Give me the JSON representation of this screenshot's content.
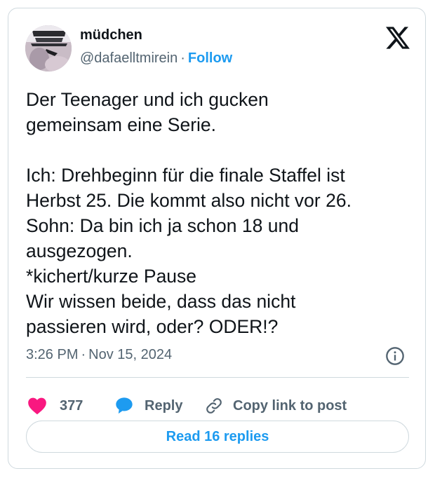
{
  "author": {
    "display_name": "müdchen",
    "handle": "@dafaelltmirein",
    "separator": "·",
    "follow_label": "Follow"
  },
  "tweet": {
    "text": "Der Teenager und ich gucken\ngemeinsam eine Serie.\n\nIch: Drehbeginn für die finale Staffel ist\nHerbst 25. Die kommt also nicht vor 26.\nSohn: Da bin ich ja schon 18 und\nausgezogen.\n*kichert/kurze Pause\nWir wissen beide, dass das nicht\npassieren wird, oder? ODER!?",
    "time": "3:26 PM",
    "separator": "·",
    "date": "Nov 15, 2024"
  },
  "actions": {
    "like_count": "377",
    "reply_label": "Reply",
    "copy_link_label": "Copy link to post",
    "read_replies_label": "Read 16 replies"
  },
  "icons": {
    "platform_logo": "x-logo-icon",
    "info": "info-icon",
    "like": "heart-icon",
    "reply": "speech-bubble-icon",
    "copy_link": "link-icon"
  },
  "colors": {
    "heart": "#f91880",
    "accent": "#1d9bf0",
    "text_primary": "#0f1419",
    "text_secondary": "#536471",
    "border": "#cfd9de"
  }
}
